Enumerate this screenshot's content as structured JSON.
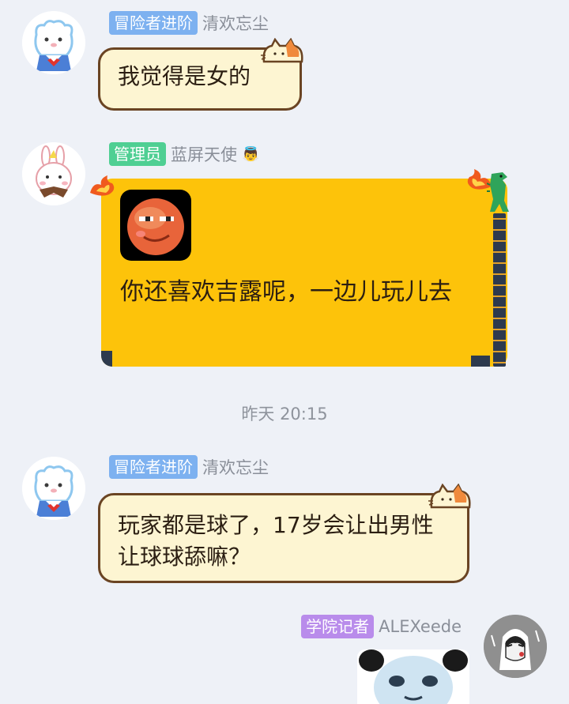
{
  "messages": [
    {
      "badge": "冒险者进阶",
      "name": "清欢忘尘",
      "text": "我觉得是女的"
    },
    {
      "badge": "管理员",
      "name": "蓝屏天使",
      "name_emoji": "👼",
      "text": "你还喜欢吉露呢，一边儿玩儿去"
    },
    {
      "badge": "冒险者进阶",
      "name": "清欢忘尘",
      "text": "玩家都是球了，17岁会让出男性让球球舔嘛？"
    },
    {
      "badge": "学院记者",
      "name": "ALEXeede"
    }
  ],
  "timestamp": "昨天 20:15",
  "colors": {
    "background": "#eef1f7",
    "badge_blue": "#7db1f0",
    "badge_green": "#4fcf93",
    "badge_purple": "#b98ceb",
    "bubble_fill": "#fdf5d2",
    "bubble_border": "#6a4423",
    "yellow_bubble": "#fdc30a"
  },
  "icons": {
    "avatar_1": "bear-sailor-avatar-icon",
    "avatar_2": "bunny-avatar-icon",
    "avatar_3": "bear-sailor-avatar-icon",
    "avatar_4": "sketch-girl-avatar-icon",
    "sticker": "red-ball-face-sticker-icon",
    "sticker_2": "panda-meme-sticker-icon"
  }
}
